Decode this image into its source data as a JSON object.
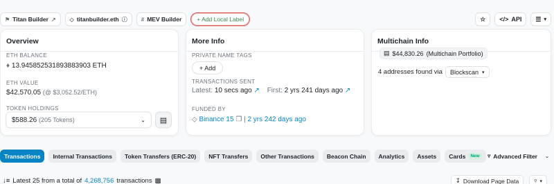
{
  "tags": {
    "titan": "Titan Builder",
    "titan_ext_icon": "external-link-icon",
    "ens": "titanbuilder.eth",
    "ens_info_icon": "info-icon",
    "mev": "MEV Builder",
    "add_label": "+ Add Local Label"
  },
  "actions": {
    "star_icon": "star-icon",
    "api": "API",
    "menu_icon": "list-icon"
  },
  "overview": {
    "title": "Overview",
    "eth_balance_label": "ETH BALANCE",
    "eth_balance_value": "13.945852531893883903 ETH",
    "eth_value_label": "ETH VALUE",
    "eth_value_value": "$42,570.05",
    "eth_value_rate": "(@ $3,052.52/ETH)",
    "token_holdings_label": "TOKEN HOLDINGS",
    "token_holdings_value": "$588.26",
    "token_holdings_count": "(205 Tokens)"
  },
  "more_info": {
    "title": "More Info",
    "private_tags_label": "PRIVATE NAME TAGS",
    "add_button": "+ Add",
    "tx_sent_label": "TRANSACTIONS SENT",
    "latest_label": "Latest:",
    "latest_value": "10 secs ago",
    "first_label": "First:",
    "first_value": "2 yrs 241 days ago",
    "funded_by_label": "FUNDED BY",
    "funded_by_value": "Binance 15",
    "funded_time": "2 yrs 242 days ago"
  },
  "multichain": {
    "title": "Multichain Info",
    "portfolio_value": "$44,830.26",
    "portfolio_label": "(Multichain Portfolio)",
    "addresses_text": "4 addresses found via",
    "explorer_option": "Blockscan"
  },
  "tabs": [
    {
      "label": "Transactions",
      "active": true
    },
    {
      "label": "Internal Transactions"
    },
    {
      "label": "Token Transfers (ERC-20)"
    },
    {
      "label": "NFT Transfers"
    },
    {
      "label": "Other Transactions"
    },
    {
      "label": "Beacon Chain"
    },
    {
      "label": "Analytics"
    },
    {
      "label": "Assets"
    },
    {
      "label": "Cards",
      "badge": "New"
    }
  ],
  "advanced_filter": "Advanced Filter",
  "bottom": {
    "prefix": "Latest 25 from a total of",
    "total": "4,268,756",
    "suffix": "transactions",
    "download": "Download Page Data"
  },
  "colors": {
    "accent": "#0784c3",
    "add_label_border": "#e05252",
    "add_label_text": "#3b8a4a"
  }
}
